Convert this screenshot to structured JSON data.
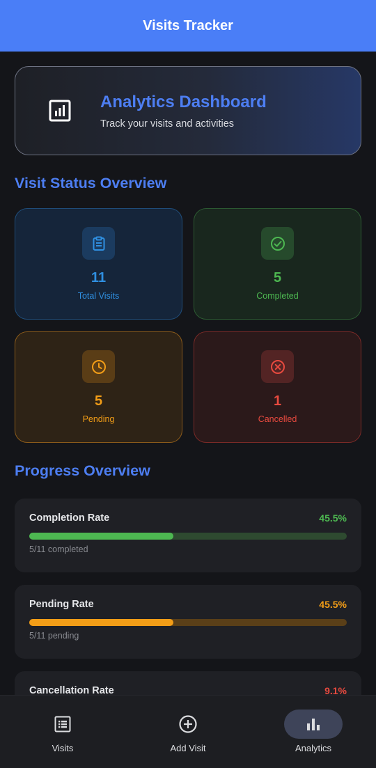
{
  "app_title": "Visits Tracker",
  "hero": {
    "title": "Analytics Dashboard",
    "subtitle": "Track your visits and activities",
    "icon": "analytics-chart-icon"
  },
  "status_section_title": "Visit Status Overview",
  "stats": [
    {
      "value": "11",
      "label": "Total Visits",
      "icon": "clipboard-icon",
      "color": "#2f8fe0"
    },
    {
      "value": "5",
      "label": "Completed",
      "icon": "check-circle-icon",
      "color": "#4db851"
    },
    {
      "value": "5",
      "label": "Pending",
      "icon": "clock-icon",
      "color": "#f29d17"
    },
    {
      "value": "1",
      "label": "Cancelled",
      "icon": "cancel-circle-icon",
      "color": "#e84a3f"
    }
  ],
  "progress_section_title": "Progress Overview",
  "progress": [
    {
      "title": "Completion Rate",
      "value": "45.5%",
      "fraction": 0.455,
      "detail": "5/11 completed",
      "color": "#4db851"
    },
    {
      "title": "Pending Rate",
      "value": "45.5%",
      "fraction": 0.455,
      "detail": "5/11 pending",
      "color": "#f29d17"
    },
    {
      "title": "Cancellation Rate",
      "value": "9.1%",
      "fraction": 0.091,
      "detail": "",
      "color": "#e84a3f"
    }
  ],
  "nav": [
    {
      "label": "Visits",
      "icon": "list-icon",
      "active": false
    },
    {
      "label": "Add Visit",
      "icon": "add-circle-icon",
      "active": false
    },
    {
      "label": "Analytics",
      "icon": "bar-chart-icon",
      "active": true
    }
  ]
}
